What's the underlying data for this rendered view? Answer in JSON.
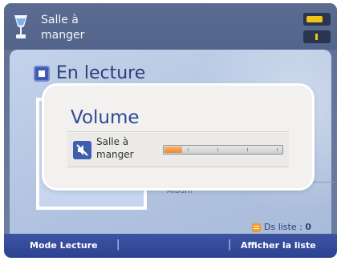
{
  "header": {
    "zone_name": "Salle à\nmanger",
    "icons": [
      "zone-cup-icon",
      "battery-icon",
      "signal-icon"
    ]
  },
  "main": {
    "section_title": "En lecture",
    "section_icon": "now-playing-icon",
    "album_label": "Album",
    "queue": {
      "label": "Ds liste : ",
      "count": "0",
      "icon": "list-icon"
    }
  },
  "softkeys": {
    "left": "Mode Lecture",
    "separator": "|",
    "right": "Afficher la liste"
  },
  "volume_popup": {
    "title": "Volume",
    "zone_label": "Salle à\nmanger",
    "mute_icon": "muted-speaker-icon",
    "level": 0.15
  },
  "colors": {
    "accent": "#3d54a3",
    "volume_fill": "#ec8a2f",
    "battery": "#f2c418"
  }
}
